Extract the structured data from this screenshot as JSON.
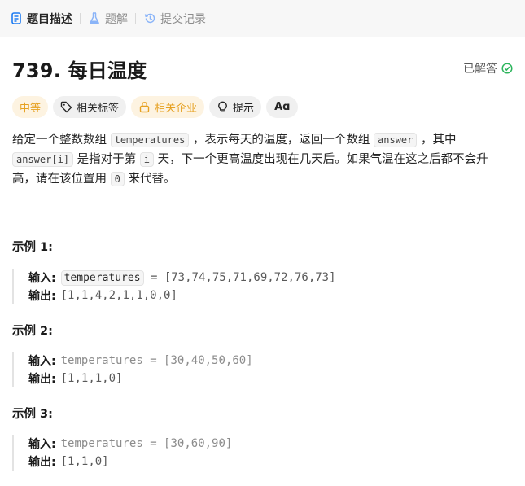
{
  "tabs": [
    {
      "label": "题目描述",
      "icon": "document-icon",
      "active": true
    },
    {
      "label": "题解",
      "icon": "flask-icon",
      "active": false
    },
    {
      "label": "提交记录",
      "icon": "history-icon",
      "active": false
    }
  ],
  "problem": {
    "title": "739. 每日温度",
    "status": "已解答"
  },
  "tags": {
    "difficulty": "中等",
    "related_tags": "相关标签",
    "related_company": "相关企业",
    "hint": "提示",
    "lang_toggle": "Aɑ"
  },
  "description": {
    "p1_a": "给定一个整数数组 ",
    "code1": "temperatures",
    "p1_b": " ，表示每天的温度，返回一个数组 ",
    "code2": "answer",
    "p1_c": " ，其中 ",
    "code3": "answer[i]",
    "p1_d": " 是指对于第 ",
    "code4": "i",
    "p1_e": " 天，下一个更高温度出现在几天后。如果气温在这之后都不会升高，请在该位置用 ",
    "code5": "0",
    "p1_f": " 来代替。"
  },
  "examples": [
    {
      "title": "示例 1:",
      "input_label": "输入:",
      "input_var": "temperatures",
      "input_value": " = [73,74,75,71,69,72,76,73]",
      "output_label": "输出:",
      "output_value": "[1,1,4,2,1,1,0,0]"
    },
    {
      "title": "示例 2:",
      "input_label": "输入:",
      "input_var": "temperatures",
      "input_value": " = [30,40,50,60]",
      "output_label": "输出:",
      "output_value": "[1,1,1,0]"
    },
    {
      "title": "示例 3:",
      "input_label": "输入:",
      "input_var": "temperatures",
      "input_value": " = [30,60,90]",
      "output_label": "输出:",
      "output_value": "[1,1,0]"
    }
  ],
  "colors": {
    "accent_orange": "#e6a020",
    "success_green": "#2db55d"
  }
}
